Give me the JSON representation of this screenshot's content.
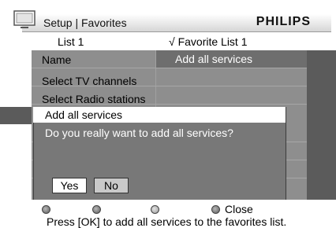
{
  "header": {
    "title": "Setup | Favorites",
    "brand": "PHILIPS",
    "left_list": "List 1",
    "check_mark": "√",
    "right_list": "Favorite List 1"
  },
  "menu": {
    "rows": [
      {
        "label": "Name"
      },
      {
        "label": "Select TV channels"
      },
      {
        "label": "Select Radio stations"
      }
    ],
    "submenu_item": "Add all services"
  },
  "dialog": {
    "title": "Add all services",
    "message": "Do you really want to add all services?",
    "yes_label": "Yes",
    "no_label": "No"
  },
  "footer": {
    "close_label": "Close",
    "hint": "Press [OK] to add all services to the favorites list."
  },
  "colors": {
    "panel": "#8e8e8e",
    "dialog": "#787878",
    "highlight": "#6e6e6e"
  }
}
